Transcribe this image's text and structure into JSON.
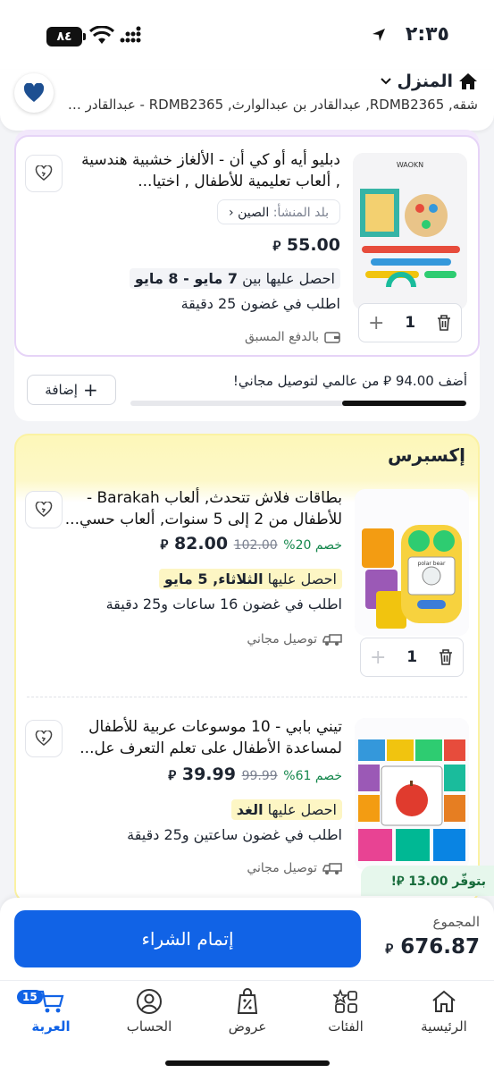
{
  "status_bar": {
    "time": "٢:٣٥",
    "battery": "٨٤"
  },
  "address": {
    "title": "المنزل",
    "subtitle": "شقه, RDMB2365, عبدالقادر بن عبدالوارث, RDMB2365 - عبدالقادر بـ..."
  },
  "cart_items": [
    {
      "title": "دبليو أيه أو كي أن - الألغاز خشبية هندسية , ألعاب تعليمية للأطفال , اختيا...",
      "origin_label": "بلد المنشأ:",
      "origin_value": "الصين",
      "price": "55.00",
      "delivery_prefix": "احصل عليها بين",
      "delivery_date": "7 مايو - 8 مايو",
      "order_within": "اطلب في غضون 25 دقيقة",
      "payment_note": "بالدفع المسبق",
      "quantity": "1"
    },
    {
      "title": "بطاقات فلاش تتحدث, ألعاب Barakah - للأطفال من 2 إلى 5 سنوات, ألعاب حسي...",
      "discount": "خصم 20%",
      "old_price": "102.00",
      "price": "82.00",
      "delivery_prefix": "احصل عليها",
      "delivery_date": "الثلاثاء, 5 مايو",
      "order_within": "اطلب في غضون 16 ساعات و25 دقيقة",
      "shipping_note": "توصيل مجاني",
      "quantity": "1"
    },
    {
      "title": "تيني بابي - 10 موسوعات عربية للأطفال لمساعدة الأطفال على تعلم التعرف عل...",
      "discount": "خصم 61%",
      "old_price": "99.99",
      "price": "39.99",
      "delivery_prefix": "احصل عليها",
      "delivery_date": "الغد",
      "order_within": "اطلب في غضون ساعتين و25 دقيقة",
      "shipping_note": "توصيل مجاني"
    }
  ],
  "free_delivery": {
    "message": "أضف 94.00 ⃁ من عالمي لتوصيل مجاني!",
    "add_button": "إضافة",
    "progress": 0.37
  },
  "express_label": "إكسبرس",
  "savings_badge": "بتوفّر 13.00 ⃁!",
  "checkout": {
    "total_label": "المجموع",
    "total": "676.87",
    "buy_button": "إتمام الشراء"
  },
  "currency_symbol": "⃁",
  "tabs": [
    {
      "label": "الرئيسية",
      "icon": "home-icon"
    },
    {
      "label": "الفئات",
      "icon": "categories-icon"
    },
    {
      "label": "عروض",
      "icon": "deals-icon"
    },
    {
      "label": "الحساب",
      "icon": "account-icon"
    },
    {
      "label": "العربة",
      "icon": "cart-icon",
      "badge": "15"
    }
  ],
  "colors": {
    "accent": "#1163e6",
    "express": "#fdf7b9",
    "discount": "#14874c"
  }
}
